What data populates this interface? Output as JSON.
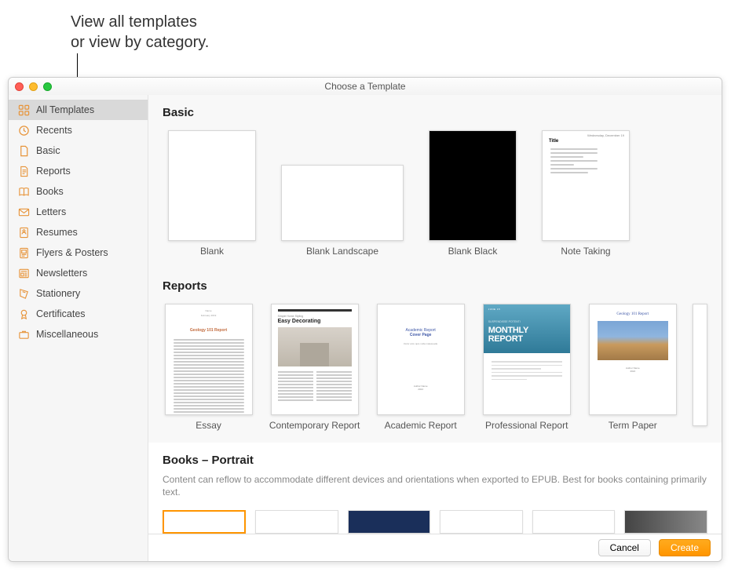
{
  "callout": {
    "line1": "View all templates",
    "line2": "or view by category."
  },
  "window": {
    "title": "Choose a Template"
  },
  "sidebar": {
    "items": [
      {
        "label": "All Templates",
        "icon": "grid"
      },
      {
        "label": "Recents",
        "icon": "clock"
      },
      {
        "label": "Basic",
        "icon": "doc"
      },
      {
        "label": "Reports",
        "icon": "doc-text"
      },
      {
        "label": "Books",
        "icon": "book"
      },
      {
        "label": "Letters",
        "icon": "envelope"
      },
      {
        "label": "Resumes",
        "icon": "person"
      },
      {
        "label": "Flyers & Posters",
        "icon": "poster"
      },
      {
        "label": "Newsletters",
        "icon": "news"
      },
      {
        "label": "Stationery",
        "icon": "stationery"
      },
      {
        "label": "Certificates",
        "icon": "ribbon"
      },
      {
        "label": "Miscellaneous",
        "icon": "misc"
      }
    ]
  },
  "sections": {
    "basic": {
      "title": "Basic",
      "templates": [
        {
          "label": "Blank"
        },
        {
          "label": "Blank Landscape"
        },
        {
          "label": "Blank Black"
        },
        {
          "label": "Note Taking"
        }
      ]
    },
    "reports": {
      "title": "Reports",
      "templates": [
        {
          "label": "Essay"
        },
        {
          "label": "Contemporary Report"
        },
        {
          "label": "Academic Report"
        },
        {
          "label": "Professional Report"
        },
        {
          "label": "Term Paper"
        }
      ]
    },
    "books": {
      "title": "Books – Portrait",
      "description": "Content can reflow to accommodate different devices and orientations when exported to EPUB. Best for books containing primarily text."
    }
  },
  "footer": {
    "cancel": "Cancel",
    "create": "Create"
  }
}
